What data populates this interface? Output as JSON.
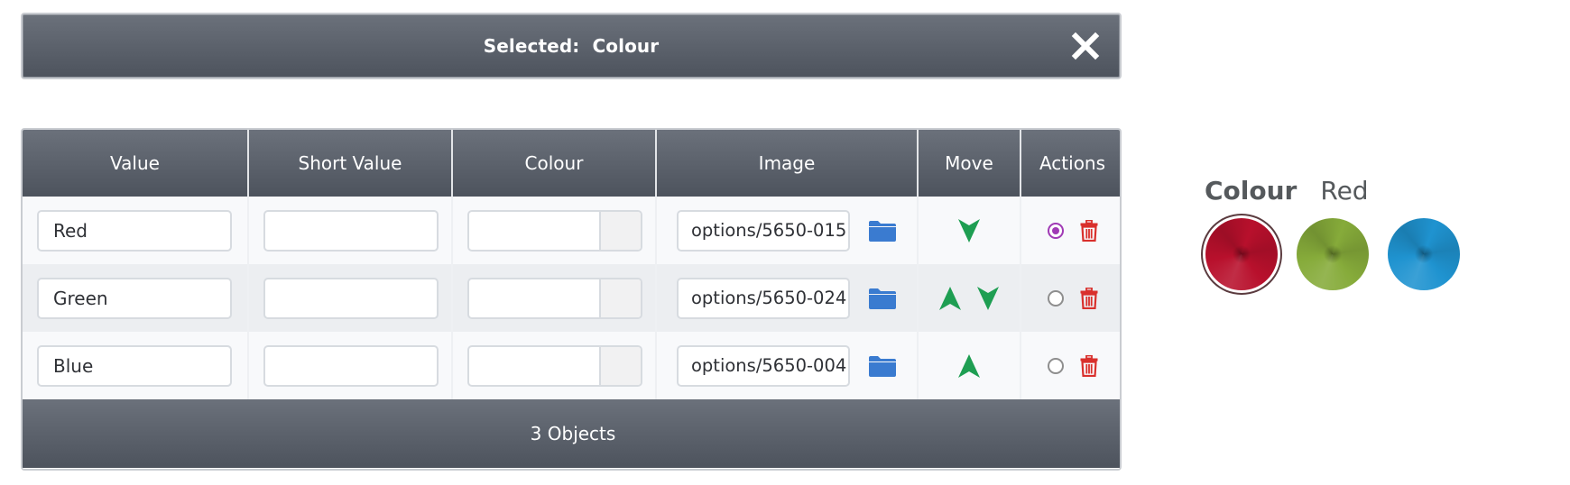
{
  "header": {
    "title_prefix": "Selected:",
    "title_value": "Colour",
    "close_icon": "close-x-icon"
  },
  "table": {
    "columns": [
      "Value",
      "Short Value",
      "Colour",
      "Image",
      "Move",
      "Actions"
    ],
    "rows": [
      {
        "value": "Red",
        "short_value": "",
        "colour": "",
        "image": "options/5650-015",
        "move": [
          "down"
        ],
        "default_selected": true
      },
      {
        "value": "Green",
        "short_value": "",
        "colour": "",
        "image": "options/5650-024",
        "move": [
          "up",
          "down"
        ],
        "default_selected": false
      },
      {
        "value": "Blue",
        "short_value": "",
        "colour": "",
        "image": "options/5650-004",
        "move": [
          "up"
        ],
        "default_selected": false
      }
    ],
    "footer": "3 Objects"
  },
  "icons": {
    "folder": "folder-icon",
    "up": "arrow-up-icon",
    "down": "arrow-down-icon",
    "trash": "trash-icon",
    "radio": "radio-icon"
  },
  "colors": {
    "arrow": "#1e9e52",
    "folder": "#3a7bd0",
    "trash": "#d9302c",
    "radio_selected": "#a03ab5"
  },
  "preview": {
    "label": "Colour",
    "selected_value": "Red",
    "swatches": [
      {
        "name": "Red",
        "color": "#b8102c",
        "selected": true
      },
      {
        "name": "Green",
        "color": "#86ab3a",
        "selected": false
      },
      {
        "name": "Blue",
        "color": "#1f93d0",
        "selected": false
      }
    ]
  }
}
